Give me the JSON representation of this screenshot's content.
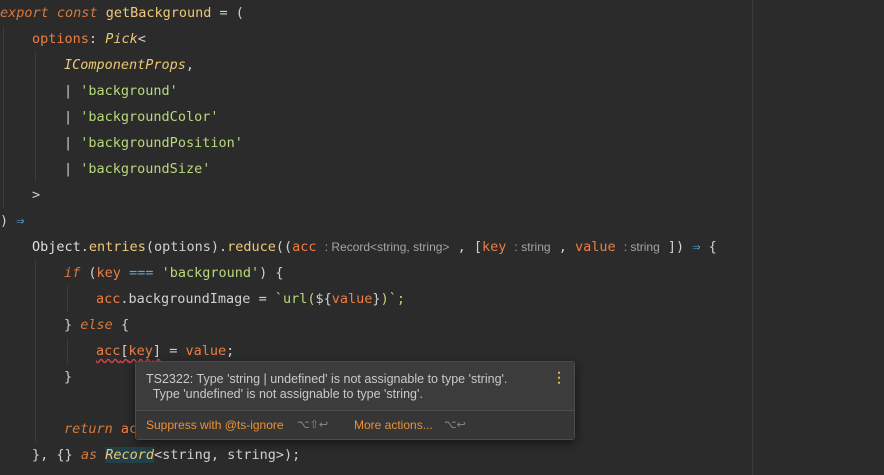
{
  "code": {
    "l1_export": "export",
    "l1_const": "const",
    "l1_name": "getBackground",
    "l1_eq": "=",
    "l1_paren": "(",
    "l2_options": "options",
    "l2_colon": ":",
    "l2_pick": "Pick",
    "l2_lt": "<",
    "l3_type": "IComponentProps",
    "l3_comma": ",",
    "pipe": "|",
    "l4_str": "'background'",
    "l5_str": "'backgroundColor'",
    "l6_str": "'backgroundPosition'",
    "l7_str": "'backgroundSize'",
    "l8_gt": ">",
    "l9_paren": ")",
    "arrow": "⇒",
    "l10_object": "Object",
    "l10_dot1": ".",
    "l10_entries": "entries",
    "l10_args": "(options)",
    "l10_dot2": ".",
    "l10_reduce": "reduce",
    "l10_open": "((",
    "l10_acc": "acc",
    "l10_hint_acc": ": Record<string, string>",
    "l10_comma1": ",",
    "l10_brk_open": "[",
    "l10_key": "key",
    "l10_hint_key": ": string",
    "l10_comma2": ",",
    "l10_value": "value",
    "l10_hint_value": ": string",
    "l10_brk_close": "])",
    "l10_brace": "{",
    "l11_if": "if",
    "l11_open": "(",
    "l11_key": "key",
    "l11_eqeq": "===",
    "l11_str": "'background'",
    "l11_close": ") {",
    "l12_acc": "acc",
    "l12_prop": ".backgroundImage",
    "l12_eq": "=",
    "l12_tick": "`",
    "l12_url": "url(",
    "l12_tpl_open": "${",
    "l12_value": "value",
    "l12_tpl_close": "}",
    "l12_url_close": ")",
    "l12_end": "`;",
    "l13_close": "}",
    "l13_else": "else",
    "l13_brace": "{",
    "l14_acc": "acc",
    "l14_lb": "[",
    "l14_key": "key",
    "l14_rb": "]",
    "l14_eq": "=",
    "l14_value": "value",
    "l14_semi": ";",
    "l15_close": "}",
    "l17_return": "return",
    "l17_acc": "ac",
    "l18_open": "},",
    "l18_obj": "{}",
    "l18_as": "as",
    "l18_record": "Record",
    "l18_generic": "<string, string>",
    "l18_end": ");"
  },
  "popup": {
    "line1": "TS2322: Type 'string | undefined' is not assignable to type 'string'.",
    "line2": "  Type 'undefined' is not assignable to type 'string'.",
    "more_icon": "⋮",
    "suppress": "Suppress with @ts-ignore",
    "suppress_shortcut": "⌥⇧↩",
    "more_actions": "More actions...",
    "more_shortcut": "⌥↩"
  },
  "colors": {
    "background": "#2b2b2c",
    "keyword": "#d67a3c",
    "string": "#b9d97a",
    "type": "#ecc776",
    "error": "#d04848",
    "action": "#ec9232"
  }
}
